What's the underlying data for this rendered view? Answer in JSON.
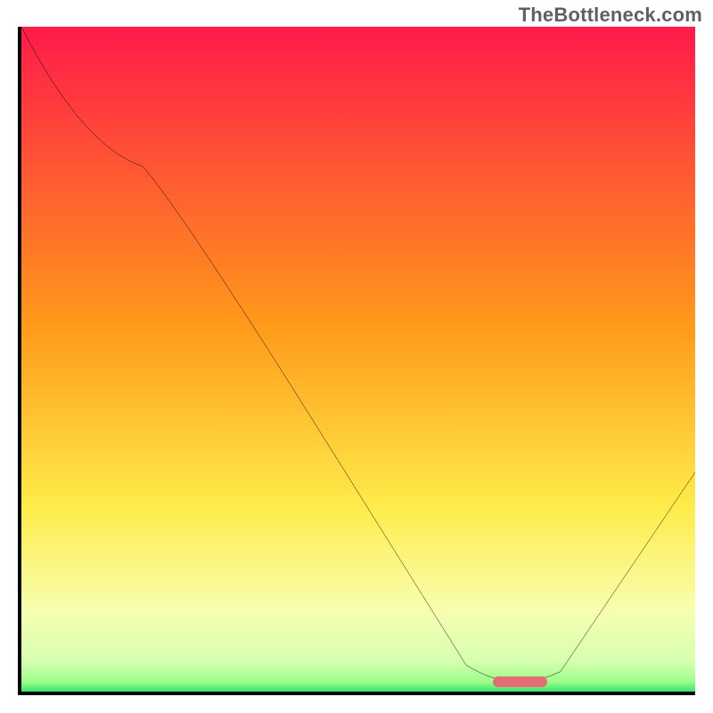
{
  "watermark": "TheBottleneck.com",
  "chart_data": {
    "type": "line",
    "title": "",
    "xlabel": "",
    "ylabel": "",
    "xlim": [
      0,
      100
    ],
    "ylim": [
      0,
      100
    ],
    "gradient_stops": [
      {
        "offset": 0,
        "color": "#ff1a4a"
      },
      {
        "offset": 0.45,
        "color": "#ff9a1a"
      },
      {
        "offset": 0.72,
        "color": "#ffeb4a"
      },
      {
        "offset": 0.88,
        "color": "#f7ffb0"
      },
      {
        "offset": 0.955,
        "color": "#d6ffb0"
      },
      {
        "offset": 0.985,
        "color": "#9cff8a"
      },
      {
        "offset": 1.0,
        "color": "#39e46f"
      }
    ],
    "curve": [
      {
        "x": 0,
        "y": 100
      },
      {
        "x": 18,
        "y": 79
      },
      {
        "x": 24,
        "y": 72
      },
      {
        "x": 66,
        "y": 4
      },
      {
        "x": 70,
        "y": 1.5
      },
      {
        "x": 77,
        "y": 1.5
      },
      {
        "x": 80,
        "y": 3
      },
      {
        "x": 100,
        "y": 33
      }
    ],
    "bottleneck_marker": {
      "x_start": 70,
      "x_end": 78,
      "y": 1.5
    }
  }
}
